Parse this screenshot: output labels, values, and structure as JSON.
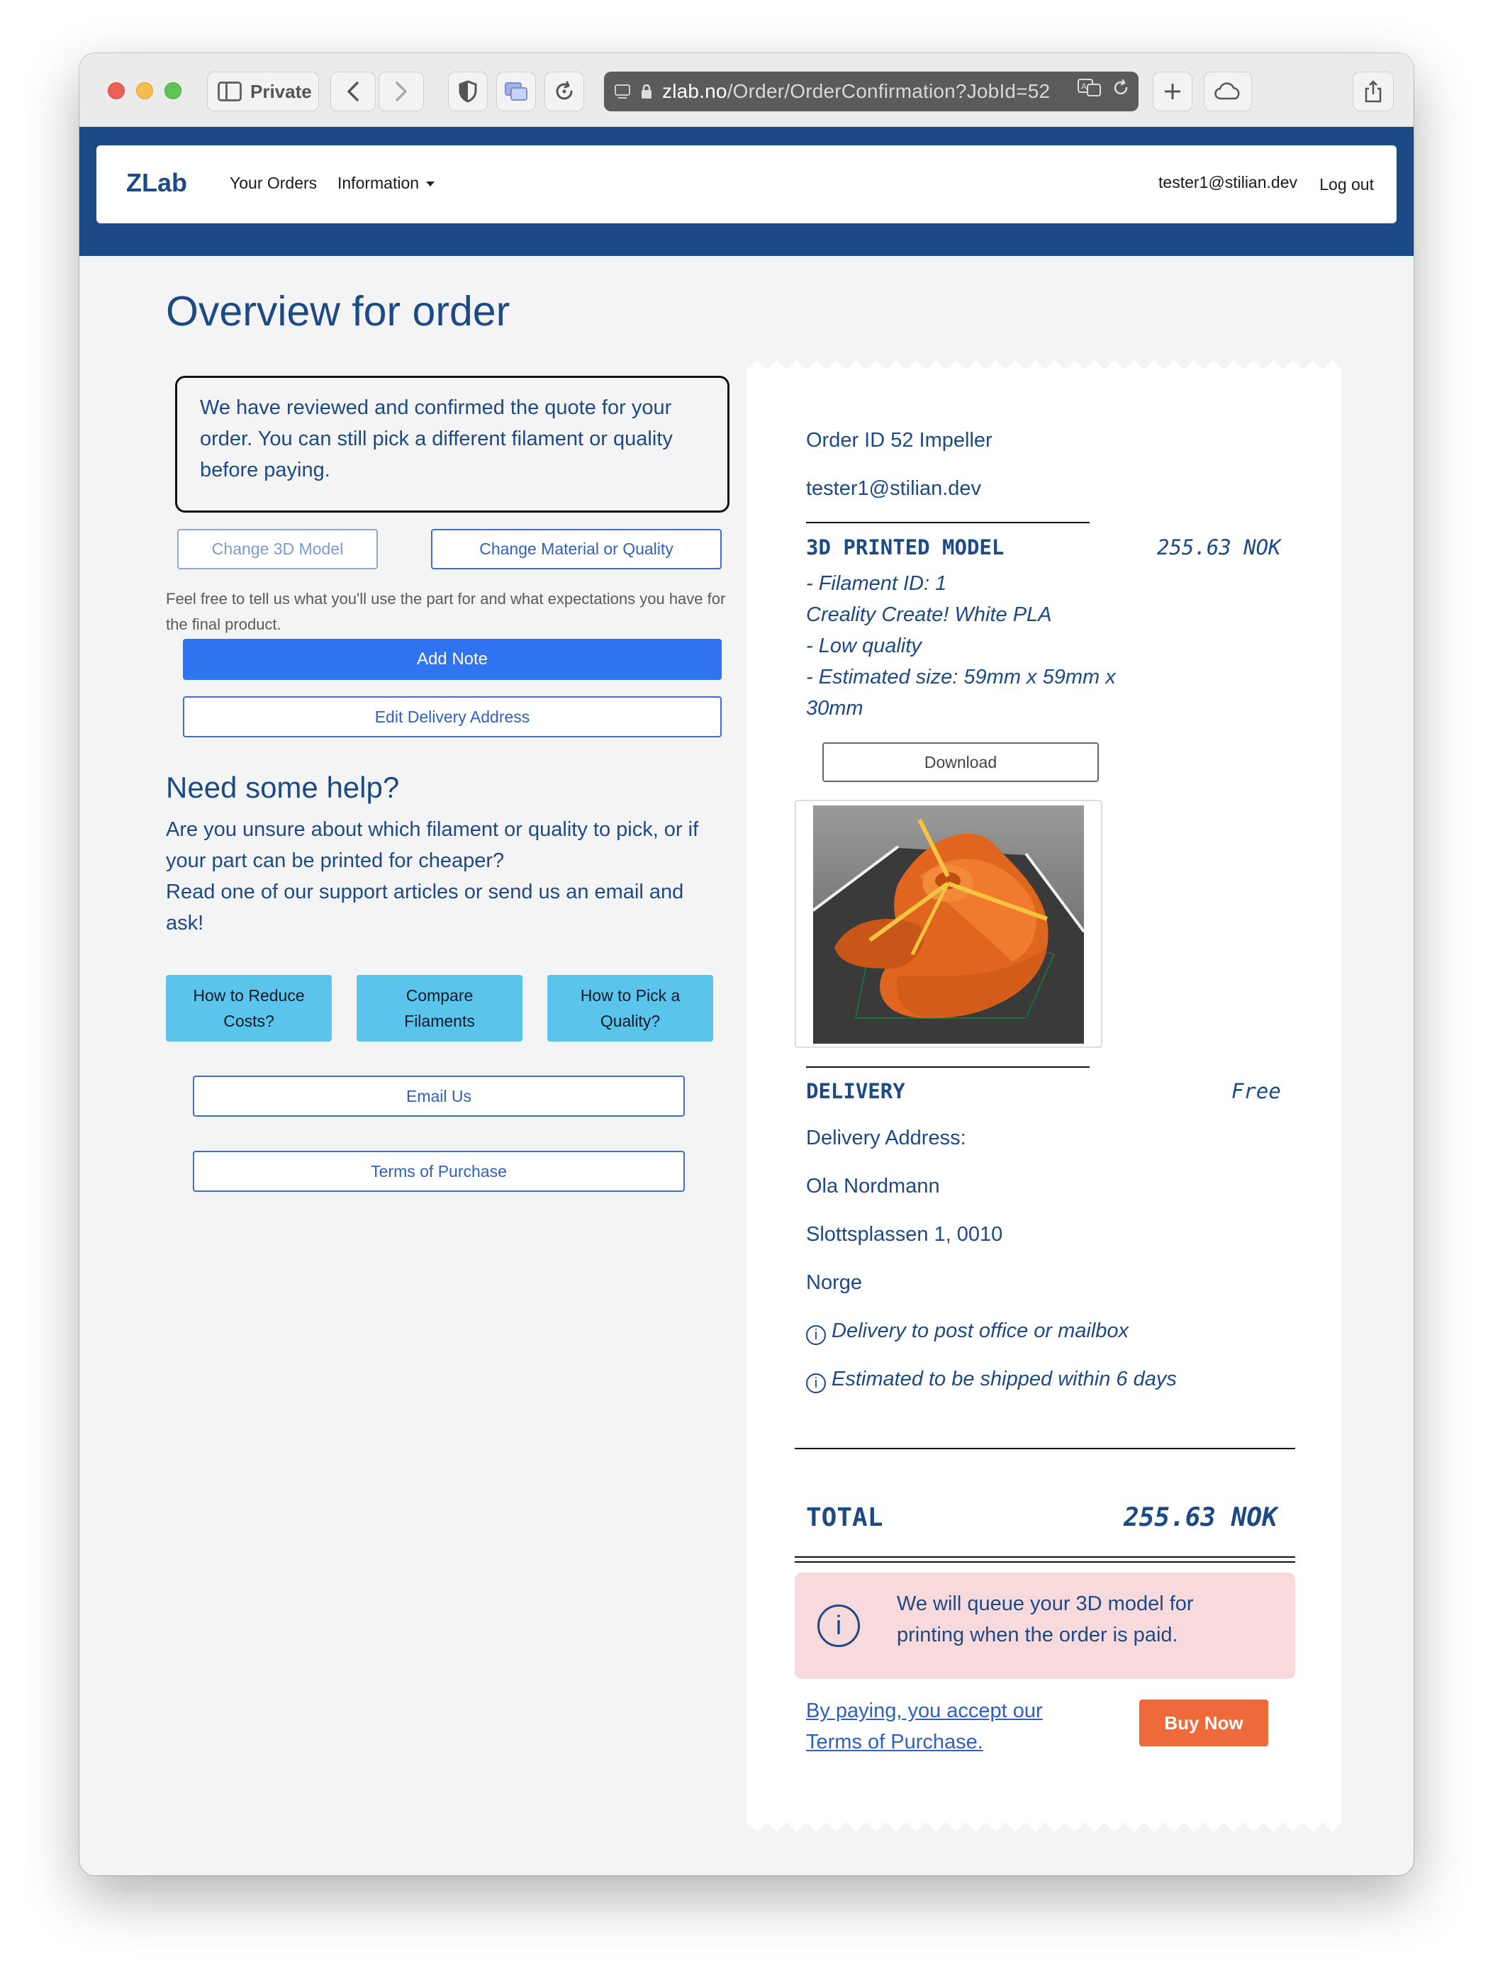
{
  "browser": {
    "private_label": "Private",
    "url_host": "zlab.no",
    "url_path": "/Order/OrderConfirmation?JobId=52"
  },
  "navbar": {
    "brand": "ZLab",
    "orders_link": "Your Orders",
    "info_link": "Information",
    "user_email": "tester1@stilian.dev",
    "logout": "Log out"
  },
  "page": {
    "title": "Overview for order",
    "notice": "We have reviewed and confirmed the quote for your order. You can still pick a different filament or quality before paying.",
    "change_model": "Change 3D Model",
    "change_material": "Change Material or Quality",
    "hint": "Feel free to tell us what you'll use the part for and what expectations you have for the final product.",
    "add_note": "Add Note",
    "edit_address": "Edit Delivery Address",
    "help_title": "Need some help?",
    "help_text_1": "Are you unsure about which filament or quality to pick, or if your part can be printed for cheaper?",
    "help_text_2": "Read one of our support articles or send us an email and ask!",
    "help_buttons": [
      "How to Reduce Costs?",
      "Compare Filaments",
      "How to Pick a Quality?"
    ],
    "email_us": "Email Us",
    "terms": "Terms of Purchase"
  },
  "receipt": {
    "order_id": "Order ID 52 Impeller",
    "email": "tester1@stilian.dev",
    "item_title": "3D PRINTED MODEL",
    "item_price": "255.63 NOK",
    "filament_id": "- Filament ID: 1",
    "filament_name": "Creality Create! White PLA",
    "quality": "- Low quality",
    "size": "- Estimated size: 59mm x 59mm x 30mm",
    "download": "Download",
    "delivery_title": "DELIVERY",
    "delivery_price": "Free",
    "address_label": "Delivery Address:",
    "name": "Ola Nordmann",
    "street": "Slottsplassen 1, 0010",
    "country": "Norge",
    "delivery_note_1": "Delivery to post office or mailbox",
    "delivery_note_2": "Estimated to be shipped within 6 days",
    "total_label": "TOTAL",
    "total_price": "255.63 NOK",
    "alert_text": "We will queue your 3D model for printing when the order is paid.",
    "pay_terms": "By paying, you accept our Terms of Purchase.",
    "buy_now": "Buy Now"
  },
  "colors": {
    "brand_blue": "#1c4a86",
    "primary_button": "#3073ef",
    "help_button": "#5bc4ea",
    "buy_button": "#ef6a3a",
    "alert_bg": "#f9dadc"
  }
}
